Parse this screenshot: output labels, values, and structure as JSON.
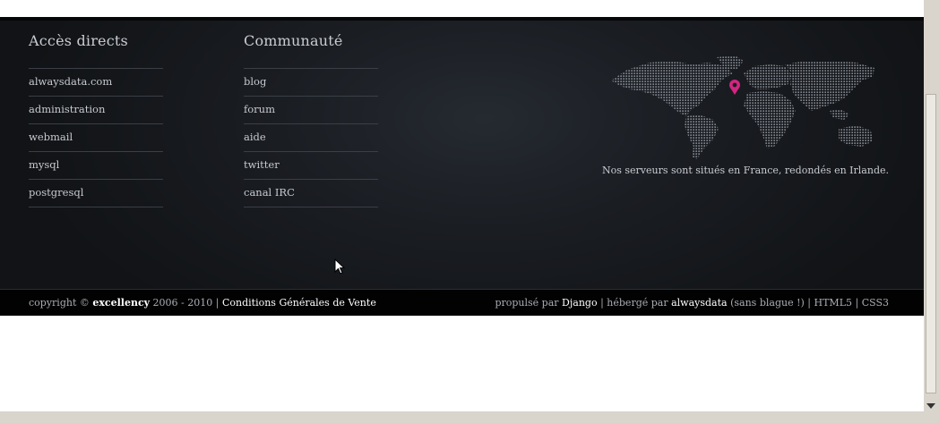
{
  "footer": {
    "col1": {
      "title": "Accès directs",
      "links": [
        "alwaysdata.com",
        "administration",
        "webmail",
        "mysql",
        "postgresql"
      ]
    },
    "col2": {
      "title": "Communauté",
      "links": [
        "blog",
        "forum",
        "aide",
        "twitter",
        "canal IRC"
      ]
    },
    "server_note": "Nos serveurs sont situés en France, redondés en Irlande.",
    "map_icon": "world-dot-map",
    "marker_color": "#d1267f"
  },
  "bottom": {
    "copyright_prefix": "copyright © ",
    "brand": "excellency",
    "years": " 2006 - 2010 | ",
    "cgv": "Conditions Générales de Vente",
    "powered_prefix": "propulsé par ",
    "django": "Django",
    "hosted_prefix": " | hébergé par ",
    "alwaysdata": "alwaysdata",
    "joke": " (sans blague !) | ",
    "html5": "HTML5",
    "sep": " | ",
    "css3": "CSS3"
  }
}
